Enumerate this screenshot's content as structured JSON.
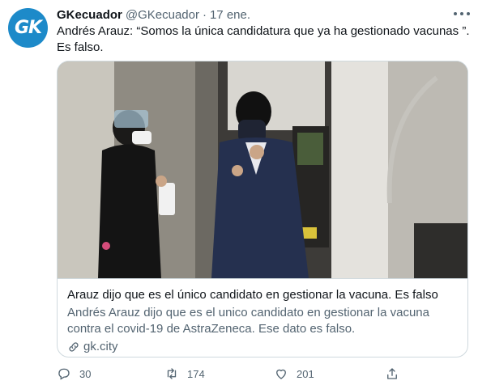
{
  "author": {
    "name": "GKecuador",
    "handle": "@GKecuador",
    "separator": "·",
    "date": "17 ene.",
    "avatar_text": "GK"
  },
  "tweet_text": "Andrés Arauz: “Somos la única candidatura que ya ha gestionado vacunas ”. Es falso.",
  "card": {
    "title": "Arauz dijo que es el único candidato en gestionar la vacuna. Es falso",
    "description": "Andrés Arauz dijo que es el unico candidato en gestionar la vacuna contra el covid-19 de AstraZeneca. Ese dato es falso.",
    "domain": "gk.city"
  },
  "actions": {
    "replies": "30",
    "retweets": "174",
    "likes": "201"
  },
  "icons": {
    "more": "more-icon",
    "link": "link-icon",
    "reply": "reply-icon",
    "retweet": "retweet-icon",
    "like": "like-icon",
    "share": "share-icon"
  },
  "colors": {
    "brand": "#1d8ac9",
    "text": "#0f1419",
    "secondary": "#536471",
    "border": "#cfd9de"
  }
}
